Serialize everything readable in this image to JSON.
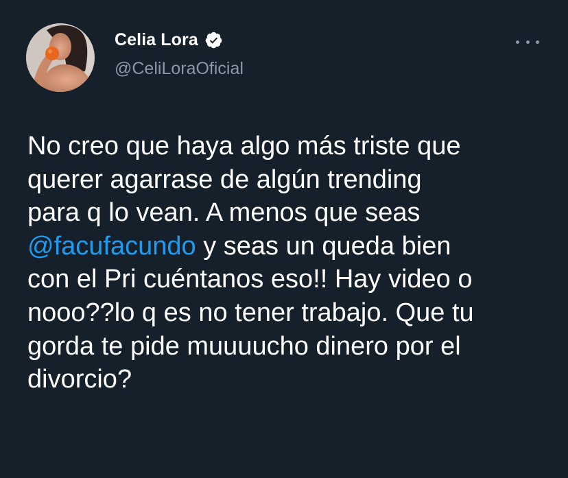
{
  "author": {
    "name": "Celia Lora",
    "handle": "@CeliLoraOficial",
    "verified": true,
    "verified_icon": "verified-badge-icon",
    "avatar_icon": "profile-photo"
  },
  "menu": {
    "icon": "more-options-icon"
  },
  "tweet": {
    "line1": "No creo que haya algo más triste que",
    "line2": "querer agarrase de algún trending",
    "line3": "para q lo vean. A menos que seas",
    "mention": "@facufacundo",
    "line4_rest": " y seas un queda bien",
    "line5": "con el Pri cuéntanos eso!! Hay video o",
    "line6": "nooo??lo q es no tener trabajo. Que tu",
    "line7": "gorda te pide muuuucho dinero por el",
    "line8": "divorcio?"
  },
  "colors": {
    "background": "#15202b",
    "text": "#ffffff",
    "secondary": "#8b98a5",
    "link": "#1d9bf0"
  }
}
